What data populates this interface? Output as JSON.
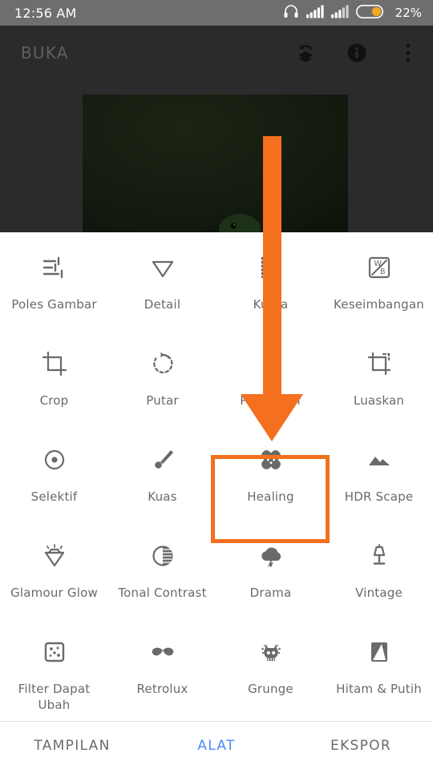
{
  "statusbar": {
    "time": "12:56 AM",
    "battery_percent": "22%",
    "icons": [
      "headphones-icon",
      "signal-sim1-icon",
      "signal-sim2-icon",
      "battery-icon"
    ]
  },
  "appbar": {
    "title": "BUKA",
    "icons": [
      "undo-stack-icon",
      "info-icon",
      "overflow-menu-icon"
    ]
  },
  "preview": {
    "name": "photo-preview"
  },
  "tools": {
    "rows": [
      [
        {
          "label": "Poles Gambar",
          "icon": "tune-sliders-icon"
        },
        {
          "label": "Detail",
          "icon": "triangle-detail-icon"
        },
        {
          "label": "Kurva",
          "icon": "curves-icon"
        },
        {
          "label": "Keseimbangan",
          "icon": "white-balance-icon"
        }
      ],
      [
        {
          "label": "Crop",
          "icon": "crop-icon"
        },
        {
          "label": "Putar",
          "icon": "rotate-icon"
        },
        {
          "label": "Perspektif",
          "icon": "perspective-icon"
        },
        {
          "label": "Luaskan",
          "icon": "expand-icon"
        }
      ],
      [
        {
          "label": "Selektif",
          "icon": "selective-icon"
        },
        {
          "label": "Kuas",
          "icon": "brush-icon"
        },
        {
          "label": "Healing",
          "icon": "healing-bandage-icon"
        },
        {
          "label": "HDR Scape",
          "icon": "hdr-mountain-icon"
        }
      ],
      [
        {
          "label": "Glamour Glow",
          "icon": "diamond-glow-icon"
        },
        {
          "label": "Tonal Contrast",
          "icon": "tonal-contrast-icon"
        },
        {
          "label": "Drama",
          "icon": "storm-cloud-icon"
        },
        {
          "label": "Vintage",
          "icon": "lamp-icon"
        }
      ],
      [
        {
          "label": "Filter Dapat Ubah",
          "icon": "grain-dice-icon"
        },
        {
          "label": "Retrolux",
          "icon": "moustache-icon"
        },
        {
          "label": "Grunge",
          "icon": "grunge-skull-icon"
        },
        {
          "label": "Hitam & Putih",
          "icon": "black-white-icon"
        }
      ]
    ],
    "highlighted": "Healing"
  },
  "bottomnav": {
    "items": [
      {
        "label": "TAMPILAN",
        "active": false
      },
      {
        "label": "ALAT",
        "active": true
      },
      {
        "label": "EKSPOR",
        "active": false
      }
    ]
  },
  "annotation": {
    "name": "orange-down-arrow",
    "color": "#f4701f",
    "points_to": "Healing"
  },
  "colors": {
    "accent_orange": "#f4701f",
    "active_blue": "#4c8bf5",
    "statusbar_gray": "#6e6e6e",
    "app_dark": "#2b2b2b",
    "icon_gray": "#6a6a6a"
  }
}
